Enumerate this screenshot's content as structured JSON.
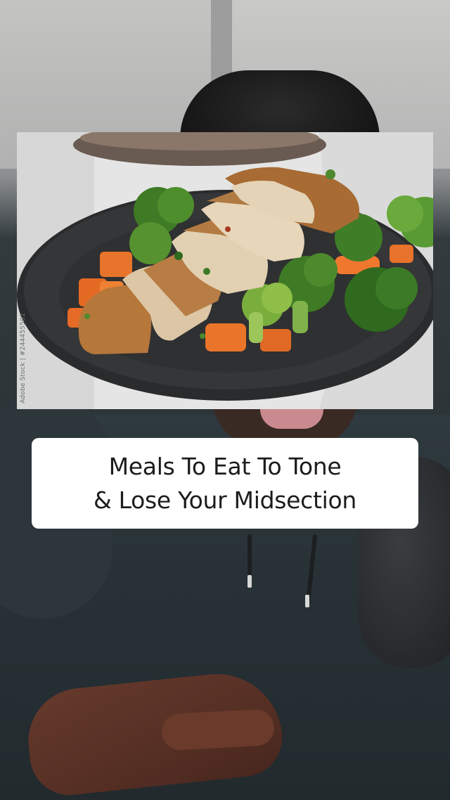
{
  "photo": {
    "watermark": "Adobe Stock | #244455501"
  },
  "caption": {
    "line1": "Meals To Eat To Tone",
    "line2": "& Lose Your Midsection"
  },
  "colors": {
    "caption_bg": "#ffffff",
    "caption_text": "#1c1c1c"
  }
}
